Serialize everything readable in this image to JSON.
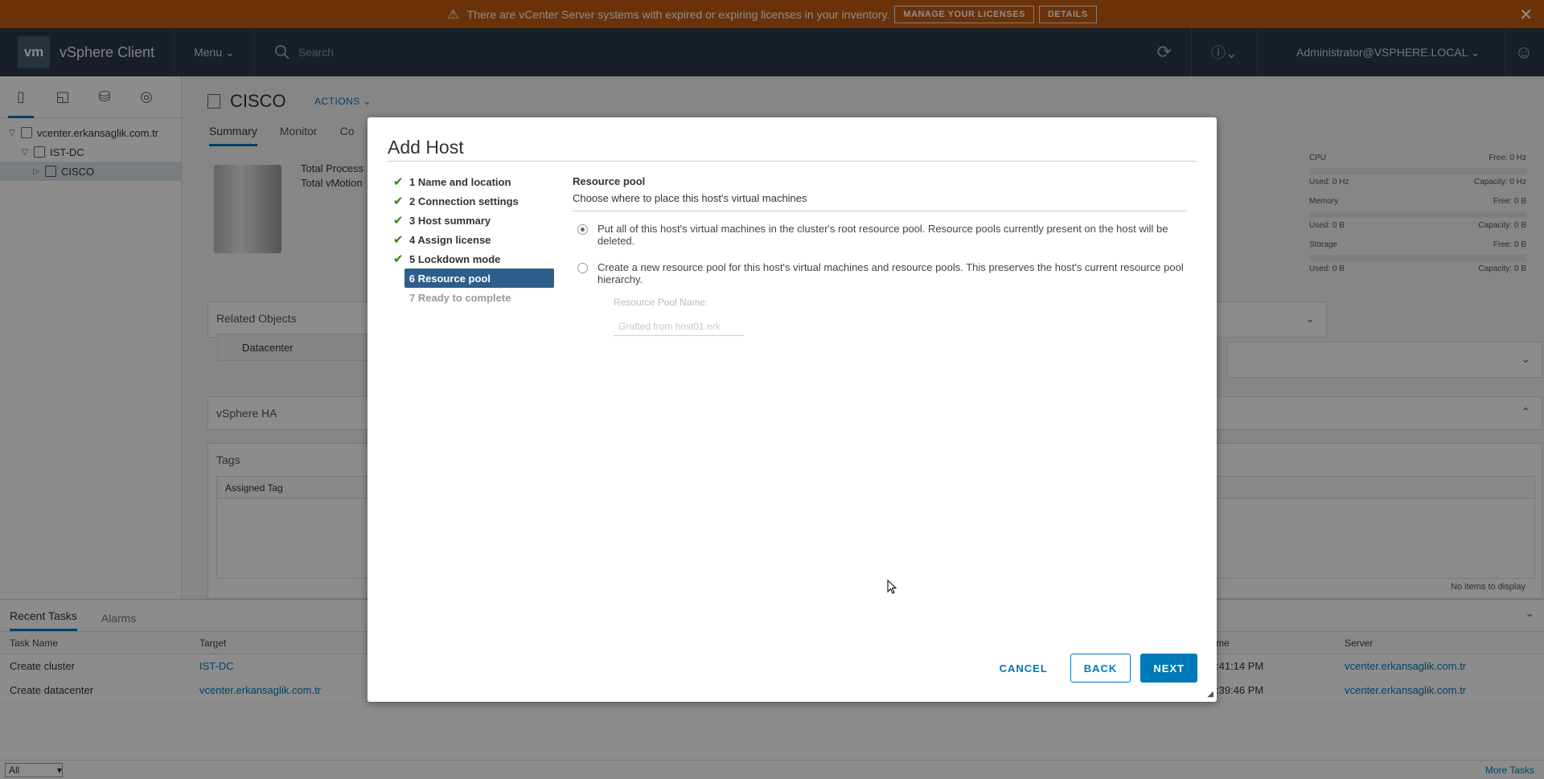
{
  "banner": {
    "message": "There are vCenter Server systems with expired or expiring licenses in your inventory.",
    "manage_label": "MANAGE YOUR LICENSES",
    "details_label": "DETAILS",
    "close": "✕"
  },
  "header": {
    "logo": "vm",
    "app_title": "vSphere Client",
    "menu": "Menu",
    "search_placeholder": "Search",
    "user": "Administrator@VSPHERE.LOCAL"
  },
  "nav": {
    "tree": [
      {
        "label": "vcenter.erkansaglik.com.tr"
      },
      {
        "label": "IST-DC"
      },
      {
        "label": "CISCO"
      }
    ]
  },
  "main": {
    "title": "CISCO",
    "actions": "ACTIONS",
    "tabs": [
      "Summary",
      "Monitor",
      "Co"
    ],
    "total_process": "Total Process",
    "total_vmotion": "Total vMotion",
    "related_objects": "Related Objects",
    "datacenter": "Datacenter",
    "vsphere_ha": "vSphere HA",
    "tags": "Tags",
    "assigned_tag": "Assigned Tag",
    "no_items": "No items to display",
    "resources": {
      "cpu": "CPU",
      "cpu_free": "Free: 0 Hz",
      "cpu_used": "Used: 0 Hz",
      "cpu_capacity": "Capacity: 0 Hz",
      "memory": "Memory",
      "mem_free": "Free: 0 B",
      "mem_used": "Used: 0 B",
      "mem_capacity": "Capacity: 0 B",
      "storage": "Storage",
      "sto_free": "Free: 0 B",
      "sto_used": "Used: 0 B",
      "sto_capacity": "Capacity: 0 B"
    }
  },
  "tasks": {
    "tabs": [
      "Recent Tasks",
      "Alarms"
    ],
    "headers": {
      "task_name": "Task Name",
      "target": "Target",
      "time": "me",
      "server": "Server"
    },
    "rows": [
      {
        "name": "Create cluster",
        "target": "IST-DC",
        "time": ":41:14 PM",
        "server": "vcenter.erkansaglik.com.tr"
      },
      {
        "name": "Create datacenter",
        "target": "vcenter.erkansaglik.com.tr",
        "time": ":39:46 PM",
        "server": "vcenter.erkansaglik.com.tr"
      }
    ],
    "filter": "All",
    "more": "More Tasks"
  },
  "dialog": {
    "title": "Add Host",
    "steps": [
      {
        "label": "1 Name and location"
      },
      {
        "label": "2 Connection settings"
      },
      {
        "label": "3 Host summary"
      },
      {
        "label": "4 Assign license"
      },
      {
        "label": "5 Lockdown mode"
      },
      {
        "label": "6 Resource pool"
      },
      {
        "label": "7 Ready to complete"
      }
    ],
    "section_title": "Resource pool",
    "section_desc": "Choose where to place this host's virtual machines",
    "option1": "Put all of this host's virtual machines in the cluster's root resource pool. Resource pools currently present on the host will be deleted.",
    "option2": "Create a new resource pool for this host's virtual machines and resource pools. This preserves the host's current resource pool hierarchy.",
    "pool_name_label": "Resource Pool Name:",
    "pool_name_value": "Grafted from host01.erk",
    "cancel": "CANCEL",
    "back": "BACK",
    "next": "NEXT"
  }
}
